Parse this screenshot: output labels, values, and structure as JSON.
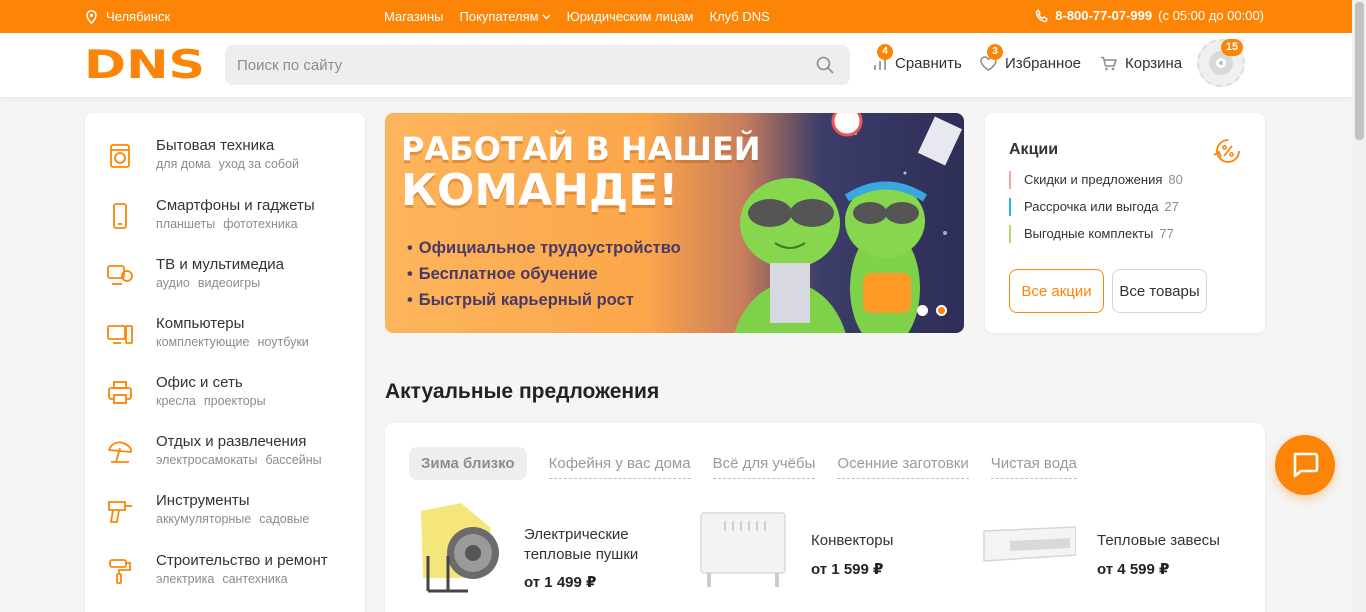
{
  "topbar": {
    "city": "Челябинск",
    "nav": [
      "Магазины",
      "Покупателям",
      "Юридическим лицам",
      "Клуб DNS"
    ],
    "phone": "8-800-77-07-999",
    "hours": "(с 05:00 до 00:00)"
  },
  "header": {
    "logo": "DNS",
    "search_placeholder": "Поиск по сайту",
    "compare_label": "Сравнить",
    "compare_count": "4",
    "favorites_label": "Избранное",
    "favorites_count": "3",
    "cart_label": "Корзина",
    "profile_badge": "15"
  },
  "categories": [
    {
      "title": "Бытовая техника",
      "subs": [
        "для дома",
        "уход за собой"
      ],
      "icon": "washing-machine-icon"
    },
    {
      "title": "Смартфоны и гаджеты",
      "subs": [
        "планшеты",
        "фототехника"
      ],
      "icon": "smartphone-icon"
    },
    {
      "title": "ТВ и мультимедиа",
      "subs": [
        "аудио",
        "видеоигры"
      ],
      "icon": "tv-icon"
    },
    {
      "title": "Компьютеры",
      "subs": [
        "комплектующие",
        "ноутбуки"
      ],
      "icon": "computer-icon"
    },
    {
      "title": "Офис и сеть",
      "subs": [
        "кресла",
        "проекторы"
      ],
      "icon": "printer-icon"
    },
    {
      "title": "Отдых и развлечения",
      "subs": [
        "электросамокаты",
        "бассейны"
      ],
      "icon": "beach-umbrella-icon"
    },
    {
      "title": "Инструменты",
      "subs": [
        "аккумуляторные",
        "садовые"
      ],
      "icon": "drill-icon"
    },
    {
      "title": "Строительство и ремонт",
      "subs": [
        "электрика",
        "сантехника"
      ],
      "icon": "paint-roller-icon"
    }
  ],
  "banner": {
    "line1": "РАБОТАЙ В НАШЕЙ",
    "line2": "КОМАНДЕ!",
    "bullets": [
      "Официальное трудоустройство",
      "Бесплатное обучение",
      "Быстрый карьерный рост"
    ]
  },
  "promos": {
    "title": "Акции",
    "items": [
      {
        "label": "Скидки и предложения",
        "count": "80",
        "color": "#f3a6a0"
      },
      {
        "label": "Рассрочка или выгода",
        "count": "27",
        "color": "#27b7d3"
      },
      {
        "label": "Выгодные комплекты",
        "count": "77",
        "color": "#b5d96a"
      }
    ],
    "all_promos": "Все акции",
    "all_goods": "Все товары"
  },
  "offers": {
    "title": "Актуальные предложения",
    "tabs": [
      "Зима близко",
      "Кофейня у вас дома",
      "Всё для учёбы",
      "Осенние заготовки",
      "Чистая вода"
    ],
    "products": [
      {
        "name": "Электрические тепловые пушки",
        "price": "от 1 499 ₽"
      },
      {
        "name": "Конвекторы",
        "price": "от 1 599 ₽"
      },
      {
        "name": "Тепловые завесы",
        "price": "от 4 599 ₽"
      }
    ]
  },
  "colors": {
    "accent": "#fc8507"
  }
}
